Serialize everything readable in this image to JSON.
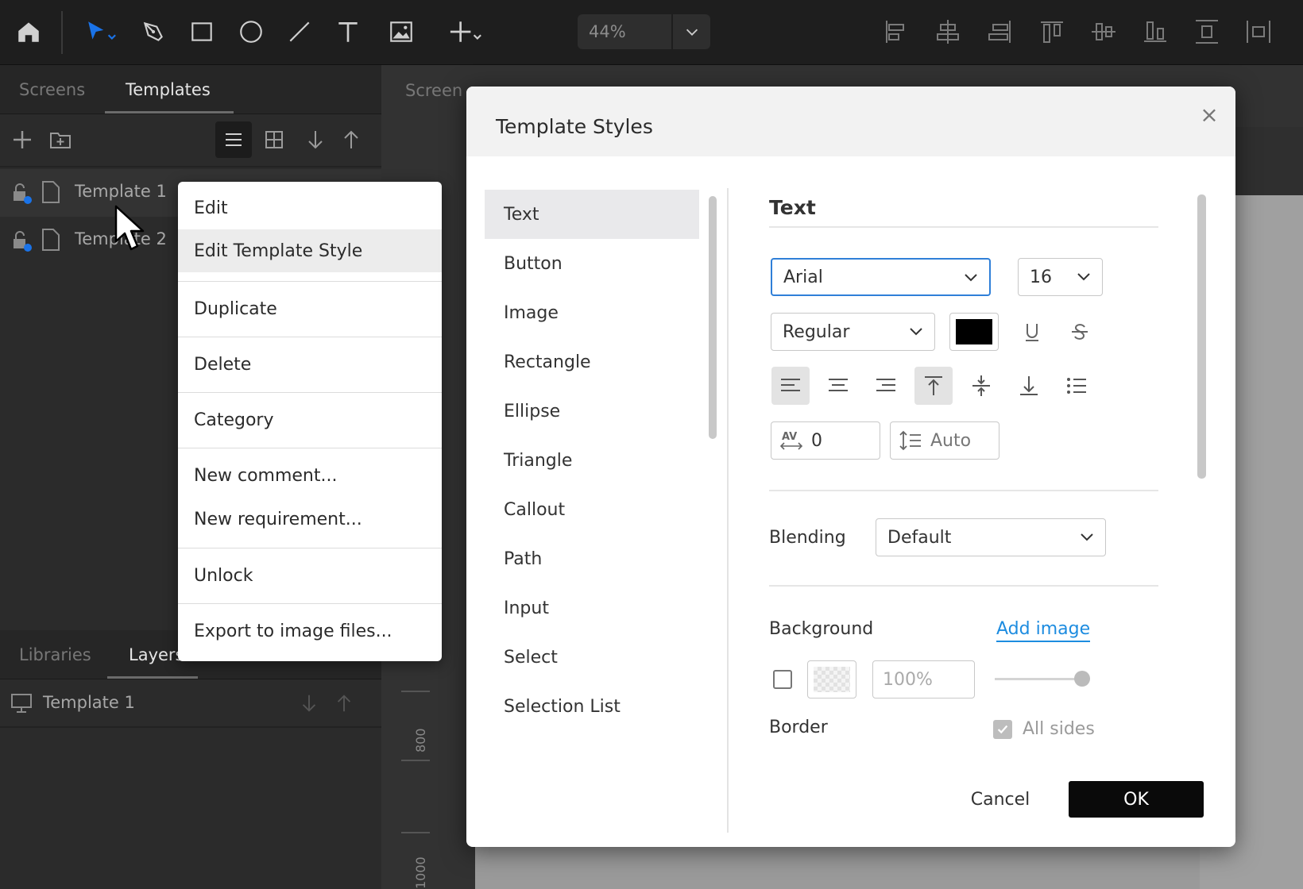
{
  "toolbar": {
    "zoom_value": "44%",
    "tools": [
      "home-icon",
      "select-arrow-icon",
      "pen-icon",
      "rectangle-icon",
      "ellipse-icon",
      "line-icon",
      "text-icon",
      "image-icon",
      "plus-icon"
    ],
    "align_tools": [
      "align-left-icon",
      "align-center-h-icon",
      "align-right-icon",
      "align-top-icon",
      "align-middle-v-icon",
      "align-bottom-icon",
      "distribute-h-icon",
      "distribute-v-icon"
    ]
  },
  "left_panel": {
    "tabs": [
      "Screens",
      "Templates"
    ],
    "active_tab": "Templates",
    "templates": [
      "Template 1",
      "Template 2"
    ],
    "bottom_tabs": [
      "Libraries",
      "Layers"
    ],
    "layers": [
      "Template 1"
    ]
  },
  "canvas": {
    "tab_text": "Screen",
    "ruler_labels": [
      "800",
      "1000"
    ]
  },
  "context_menu": {
    "items": [
      "Edit",
      "Edit Template Style",
      "Duplicate",
      "Delete",
      "Category",
      "New comment...",
      "New requirement...",
      "Unlock",
      "Export to image files..."
    ],
    "hovered": "Edit Template Style"
  },
  "dialog": {
    "title": "Template Styles",
    "close": "×",
    "categories": [
      "Text",
      "Button",
      "Image",
      "Rectangle",
      "Ellipse",
      "Triangle",
      "Callout",
      "Path",
      "Input",
      "Select",
      "Selection List"
    ],
    "selected_category": "Text",
    "section_title": "Text",
    "font_family": "Arial",
    "font_size": "16",
    "font_weight": "Regular",
    "text_color": "#000000",
    "letter_spacing": "0",
    "line_height": "Auto",
    "blending_label": "Blending",
    "blending_value": "Default",
    "background_label": "Background",
    "add_image_label": "Add image",
    "opacity_value": "100%",
    "border_label": "Border",
    "all_sides_label": "All sides",
    "cancel_label": "Cancel",
    "ok_label": "OK"
  }
}
